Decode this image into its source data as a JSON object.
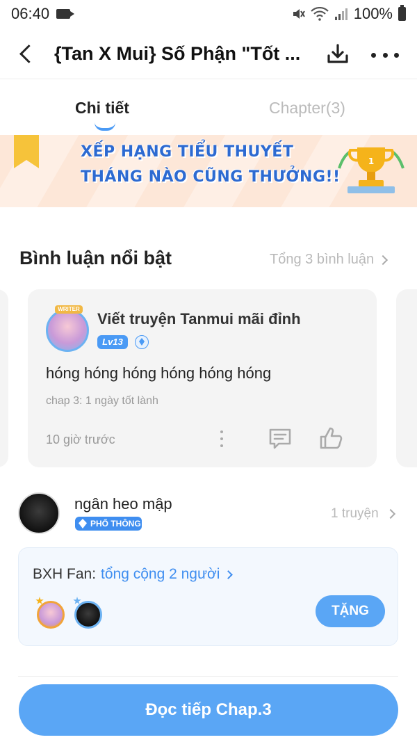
{
  "status_bar": {
    "time": "06:40",
    "battery": "100%",
    "icons": [
      "camera-icon",
      "mute-icon",
      "wifi-icon",
      "signal-icon",
      "battery-icon"
    ]
  },
  "header": {
    "title": "{Tan X Mui} Số Phận \"Tốt ...",
    "icons": [
      "back-icon",
      "download-icon",
      "more-icon"
    ]
  },
  "tabs": [
    {
      "label": "Chi tiết",
      "active": true
    },
    {
      "label": "Chapter(3)",
      "active": false
    }
  ],
  "banner": {
    "line1": "XẾP HẠNG TIỂU THUYẾT",
    "line2": "THÁNG NÀO CŨNG THƯỞNG!!"
  },
  "featured_comments": {
    "title": "Bình luận nổi bật",
    "total_link": "Tổng 3 bình luận",
    "card": {
      "avatar_tag": "WRITER",
      "author": "Viết truyện Tanmui mãi đỉnh",
      "level": "Lv13",
      "text": "hóng hóng hóng hóng hóng hóng",
      "meta": "chap 3: 1 ngày tốt lành",
      "time": "10 giờ trước"
    }
  },
  "author": {
    "name": "ngân heo mập",
    "badge": "PHỔ THÔNG",
    "stories_link": "1 truyện"
  },
  "fan_ranking": {
    "label": "BXH Fan:",
    "total_link": "tổng cộng 2 người",
    "gift_button": "TẶNG"
  },
  "read_button": "Đọc tiếp Chap.3",
  "colors": {
    "accent": "#5aa6f5",
    "link_blue": "#3f8ef0",
    "banner_bg": "#fde7d8",
    "banner_text": "#2d6ad1",
    "card_bg": "#f4f4f4"
  }
}
